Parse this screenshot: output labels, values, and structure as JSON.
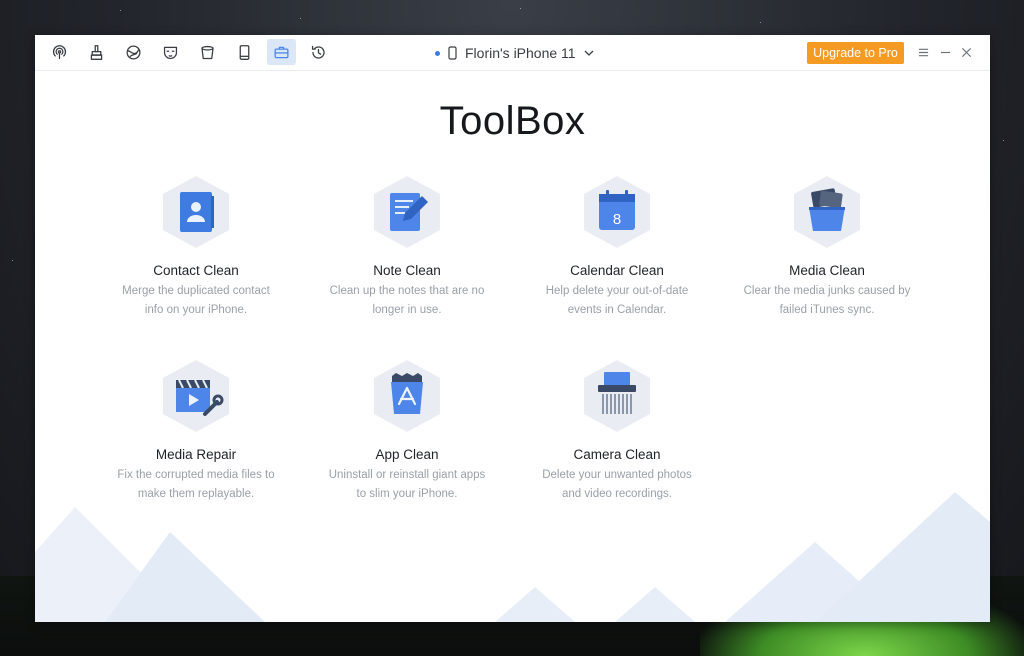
{
  "titlebar": {
    "nav_icons": [
      {
        "name": "airdrop-icon",
        "active": false
      },
      {
        "name": "cleaner-brush-icon",
        "active": false
      },
      {
        "name": "browser-privacy-icon",
        "active": false
      },
      {
        "name": "mask-privacy-icon",
        "active": false
      },
      {
        "name": "trash-bin-icon",
        "active": false
      },
      {
        "name": "phone-device-icon",
        "active": false
      },
      {
        "name": "toolbox-icon",
        "active": true
      },
      {
        "name": "history-icon",
        "active": false
      }
    ],
    "device_name": "Florin's iPhone 11",
    "upgrade_label": "Upgrade to Pro",
    "accent_color": "#f59a22",
    "active_tab_color": "#dbe6f7"
  },
  "main": {
    "title": "ToolBox",
    "tools": [
      {
        "id": "contact-clean",
        "icon": "contact-book-icon",
        "name": "Contact Clean",
        "desc_line1": "Merge the duplicated contact",
        "desc_line2": "info on your iPhone."
      },
      {
        "id": "note-clean",
        "icon": "note-pencil-icon",
        "name": "Note Clean",
        "desc_line1": "Clean up the notes that are no",
        "desc_line2": "longer in use."
      },
      {
        "id": "calendar-clean",
        "icon": "calendar-icon",
        "name": "Calendar Clean",
        "desc_line1": "Help delete your out-of-date",
        "desc_line2": "events in Calendar.",
        "calendar_number": "8"
      },
      {
        "id": "media-clean",
        "icon": "media-bucket-icon",
        "name": "Media Clean",
        "desc_line1": "Clear the media junks caused by",
        "desc_line2": "failed iTunes sync."
      },
      {
        "id": "media-repair",
        "icon": "media-repair-wrench-icon",
        "name": "Media Repair",
        "desc_line1": "Fix the corrupted media files to",
        "desc_line2": "make them replayable."
      },
      {
        "id": "app-clean",
        "icon": "app-store-bin-icon",
        "name": "App Clean",
        "desc_line1": "Uninstall or reinstall giant apps",
        "desc_line2": "to slim your iPhone."
      },
      {
        "id": "camera-clean",
        "icon": "photo-shredder-icon",
        "name": "Camera Clean",
        "desc_line1": "Delete your unwanted photos",
        "desc_line2": "and video recordings."
      }
    ],
    "hex_color": "#e9edf3",
    "icon_color": "#4d86e8"
  }
}
